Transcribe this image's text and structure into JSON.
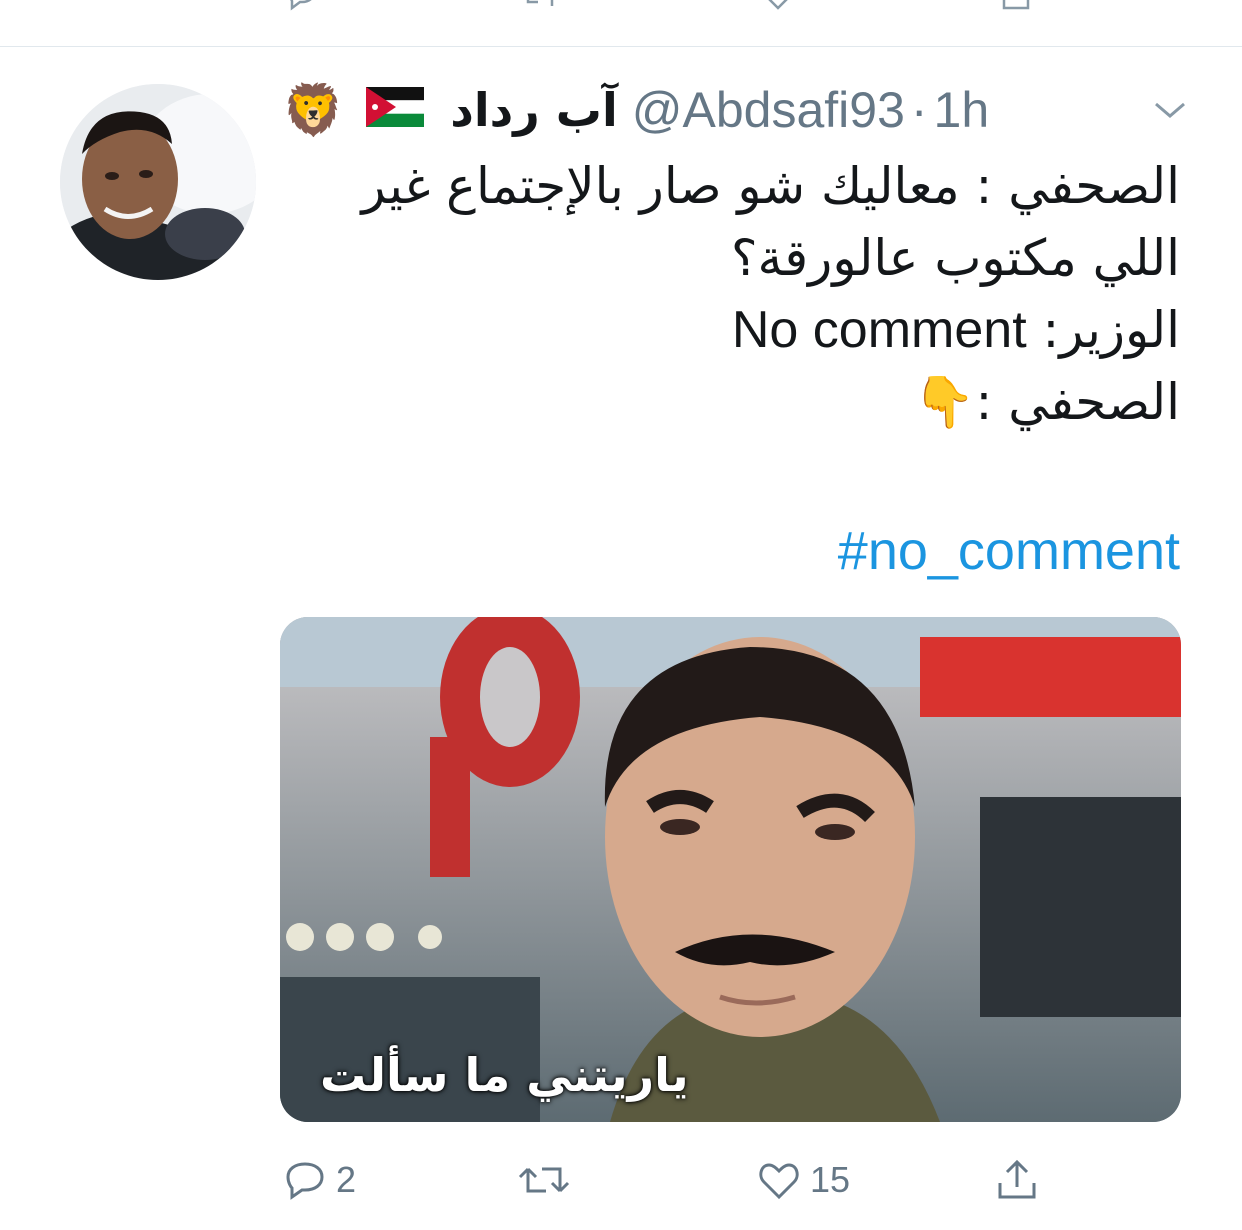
{
  "tweet": {
    "display_name": "آب رداد",
    "handle": "@Abdsafi93",
    "separator": "·",
    "time": "1h",
    "text_lines": [
      "الصحفي : معاليك شو صار بالإجتماع غير",
      "اللي مكتوب عالورقة؟"
    ],
    "line3_prefix": "الوزير:",
    "line3_english": "No comment",
    "line4_prefix": "الصحفي :",
    "pointing_emoji": "👇",
    "hashtag": "#no_comment",
    "name_emoji_lion": "🦁",
    "name_emoji_flag": "jordan-flag-icon",
    "media_caption": "ياريتني ما سألت"
  },
  "actions": {
    "reply_count": "2",
    "retweet_count": "",
    "like_count": "15"
  },
  "colors": {
    "link": "#1b95e0",
    "muted": "#657786",
    "divider": "#e1e8ed"
  }
}
